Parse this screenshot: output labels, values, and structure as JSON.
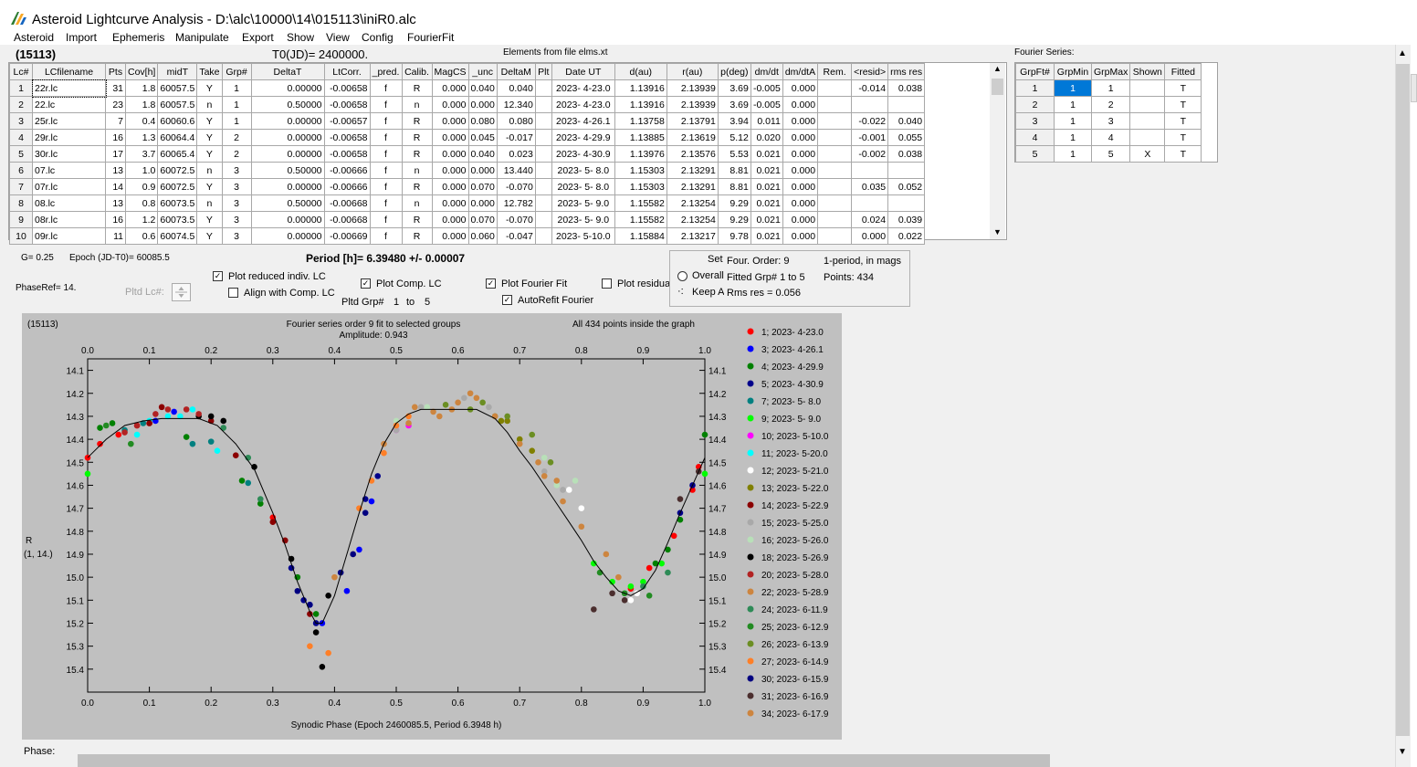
{
  "window": {
    "title": "Asteroid Lightcurve Analysis - D:\\alc\\10000\\14\\015113\\iniR0.alc"
  },
  "menu": [
    "Asteroid",
    "Import",
    "Ephemeris",
    "Manipulate",
    "Export",
    "Show",
    "View",
    "Config",
    "FourierFit"
  ],
  "header": {
    "asteroid_id": "(15113)",
    "t0": "T0(JD)= 2400000.",
    "elements": "Elements from file elms.xt",
    "fourier_title": "Fourier Series:"
  },
  "lc_table": {
    "columns": [
      "Lc#",
      "LCfilename",
      "Pts",
      "Cov[h]",
      "midT",
      "Take",
      "Grp#",
      "DeltaT",
      "LtCorr.",
      "_pred.",
      "Calib.",
      "MagCS",
      "_unc",
      "DeltaM",
      "Plt",
      "Date UT",
      "d(au)",
      "r(au)",
      "p(deg)",
      "dm/dt",
      "dm/dtA",
      "Rem.",
      "<resid>",
      "rms res"
    ],
    "rows": [
      [
        "1",
        "22r.lc",
        "31",
        "1.8",
        "60057.5",
        "Y",
        "1",
        "0.00000",
        "-0.00658",
        "f",
        "R",
        "0.000",
        "0.040",
        "0.040",
        "",
        "2023- 4-23.0",
        "1.13916",
        "2.13939",
        "3.69",
        "-0.005",
        "0.000",
        "",
        "-0.014",
        "0.038"
      ],
      [
        "2",
        "22.lc",
        "23",
        "1.8",
        "60057.5",
        "n",
        "1",
        "0.50000",
        "-0.00658",
        "f",
        "n",
        "0.000",
        "0.000",
        "12.340",
        "",
        "2023- 4-23.0",
        "1.13916",
        "2.13939",
        "3.69",
        "-0.005",
        "0.000",
        "",
        "",
        ""
      ],
      [
        "3",
        "25r.lc",
        "7",
        "0.4",
        "60060.6",
        "Y",
        "1",
        "0.00000",
        "-0.00657",
        "f",
        "R",
        "0.000",
        "0.080",
        "0.080",
        "",
        "2023- 4-26.1",
        "1.13758",
        "2.13791",
        "3.94",
        "0.011",
        "0.000",
        "",
        "-0.022",
        "0.040"
      ],
      [
        "4",
        "29r.lc",
        "16",
        "1.3",
        "60064.4",
        "Y",
        "2",
        "0.00000",
        "-0.00658",
        "f",
        "R",
        "0.000",
        "0.045",
        "-0.017",
        "",
        "2023- 4-29.9",
        "1.13885",
        "2.13619",
        "5.12",
        "0.020",
        "0.000",
        "",
        "-0.001",
        "0.055"
      ],
      [
        "5",
        "30r.lc",
        "17",
        "3.7",
        "60065.4",
        "Y",
        "2",
        "0.00000",
        "-0.00658",
        "f",
        "R",
        "0.000",
        "0.040",
        "0.023",
        "",
        "2023- 4-30.9",
        "1.13976",
        "2.13576",
        "5.53",
        "0.021",
        "0.000",
        "",
        "-0.002",
        "0.038"
      ],
      [
        "6",
        "07.lc",
        "13",
        "1.0",
        "60072.5",
        "n",
        "3",
        "0.50000",
        "-0.00666",
        "f",
        "n",
        "0.000",
        "0.000",
        "13.440",
        "",
        "2023- 5- 8.0",
        "1.15303",
        "2.13291",
        "8.81",
        "0.021",
        "0.000",
        "",
        "",
        ""
      ],
      [
        "7",
        "07r.lc",
        "14",
        "0.9",
        "60072.5",
        "Y",
        "3",
        "0.00000",
        "-0.00666",
        "f",
        "R",
        "0.000",
        "0.070",
        "-0.070",
        "",
        "2023- 5- 8.0",
        "1.15303",
        "2.13291",
        "8.81",
        "0.021",
        "0.000",
        "",
        "0.035",
        "0.052"
      ],
      [
        "8",
        "08.lc",
        "13",
        "0.8",
        "60073.5",
        "n",
        "3",
        "0.50000",
        "-0.00668",
        "f",
        "n",
        "0.000",
        "0.000",
        "12.782",
        "",
        "2023- 5- 9.0",
        "1.15582",
        "2.13254",
        "9.29",
        "0.021",
        "0.000",
        "",
        "",
        ""
      ],
      [
        "9",
        "08r.lc",
        "16",
        "1.2",
        "60073.5",
        "Y",
        "3",
        "0.00000",
        "-0.00668",
        "f",
        "R",
        "0.000",
        "0.070",
        "-0.070",
        "",
        "2023- 5- 9.0",
        "1.15582",
        "2.13254",
        "9.29",
        "0.021",
        "0.000",
        "",
        "0.024",
        "0.039"
      ],
      [
        "10",
        "09r.lc",
        "11",
        "0.6",
        "60074.5",
        "Y",
        "3",
        "0.00000",
        "-0.00669",
        "f",
        "R",
        "0.000",
        "0.060",
        "-0.047",
        "",
        "2023- 5-10.0",
        "1.15884",
        "2.13217",
        "9.78",
        "0.021",
        "0.000",
        "",
        "0.000",
        "0.022"
      ]
    ]
  },
  "fourier_table": {
    "columns": [
      "GrpFt#",
      "GrpMin",
      "GrpMax",
      "Shown",
      "Fitted"
    ],
    "rows": [
      [
        "1",
        "1",
        "1",
        "",
        "T"
      ],
      [
        "2",
        "1",
        "2",
        "",
        "T"
      ],
      [
        "3",
        "1",
        "3",
        "",
        "T"
      ],
      [
        "4",
        "1",
        "4",
        "",
        "T"
      ],
      [
        "5",
        "1",
        "5",
        "X",
        "T"
      ]
    ]
  },
  "controls": {
    "g_value": "G= 0.25",
    "epoch": "Epoch (JD-T0)= 60085.5",
    "period": "Period [h]= 6.39480 +/- 0.00007",
    "phase_ref": "PhaseRef= 14.",
    "pltd_lc": "Pltd Lc#:",
    "plot_reduced": "Plot reduced indiv. LC",
    "align_comp": "Align with Comp. LC",
    "plot_comp": "Plot Comp. LC",
    "pltd_grp": "Pltd Grp#",
    "pltd_grp_from": "1",
    "pltd_grp_to_word": "to",
    "pltd_grp_to": "5",
    "plot_fourier": "Plot Fourier Fit",
    "autorefit": "AutoRefit Fourier",
    "plot_residuals": "Plot residuals",
    "set_label": "Set",
    "overall": "Overall",
    "keep": "Keep A",
    "four_order": "Four. Order:  9",
    "one_period": "1-period, in mags",
    "fitted_grp": "Fitted Grp# 1 to 5",
    "points": "Points: 434",
    "rms_res": "Rms res    = 0.056",
    "phase_footer": "Phase:"
  },
  "checkbox_states": {
    "plot_reduced": true,
    "align_comp": false,
    "plot_comp": true,
    "plot_fourier": true,
    "autorefit": true,
    "plot_residuals": false
  },
  "chart_data": {
    "type": "scatter",
    "corner_label": "(15113)",
    "title": "Fourier series order 9 fit to selected groups",
    "subtitle": "Amplitude: 0.943",
    "note": "All 434 points inside the graph",
    "xlabel": "Synodic Phase (Epoch 2460085.5, Period 6.3948 h)",
    "ylabel": "R",
    "ylabel2": "(1, 14.)",
    "xlim": [
      0.0,
      1.0
    ],
    "ylim": [
      14.05,
      15.5
    ],
    "y_inverted": true,
    "x_ticks": [
      "0.0",
      "0.1",
      "0.2",
      "0.3",
      "0.4",
      "0.5",
      "0.6",
      "0.7",
      "0.8",
      "0.9",
      "1.0"
    ],
    "y_ticks": [
      "14.1",
      "14.2",
      "14.3",
      "14.4",
      "14.5",
      "14.6",
      "14.7",
      "14.8",
      "14.9",
      "15.0",
      "15.1",
      "15.2",
      "15.3",
      "15.4"
    ],
    "fit_curve": {
      "x": [
        0.0,
        0.03,
        0.06,
        0.09,
        0.12,
        0.15,
        0.18,
        0.21,
        0.24,
        0.27,
        0.3,
        0.32,
        0.34,
        0.36,
        0.37,
        0.38,
        0.4,
        0.42,
        0.44,
        0.46,
        0.48,
        0.5,
        0.52,
        0.54,
        0.56,
        0.6,
        0.63,
        0.66,
        0.68,
        0.7,
        0.72,
        0.74,
        0.76,
        0.78,
        0.8,
        0.82,
        0.84,
        0.86,
        0.88,
        0.9,
        0.92,
        0.94,
        0.96,
        0.98,
        1.0
      ],
      "y": [
        14.48,
        14.4,
        14.34,
        14.32,
        14.31,
        14.31,
        14.31,
        14.34,
        14.42,
        14.53,
        14.72,
        14.86,
        15.02,
        15.15,
        15.2,
        15.2,
        15.08,
        14.9,
        14.72,
        14.55,
        14.42,
        14.33,
        14.29,
        14.27,
        14.27,
        14.27,
        14.27,
        14.31,
        14.37,
        14.45,
        14.52,
        14.6,
        14.68,
        14.76,
        14.84,
        14.93,
        15.0,
        15.06,
        15.08,
        15.05,
        14.97,
        14.85,
        14.72,
        14.6,
        14.48
      ]
    },
    "series": [
      {
        "name": "1; 2023- 4-23.0",
        "color": "#ff0000",
        "x": [
          0.0,
          0.02,
          0.05,
          0.08,
          0.1,
          0.3,
          0.88,
          0.91,
          0.95,
          0.98,
          0.99
        ],
        "y": [
          14.48,
          14.42,
          14.38,
          14.34,
          14.33,
          14.74,
          15.05,
          14.96,
          14.82,
          14.62,
          14.52
        ]
      },
      {
        "name": "3; 2023- 4-26.1",
        "color": "#0000ff",
        "x": [
          0.36,
          0.38,
          0.42,
          0.44,
          0.46,
          0.11,
          0.14
        ],
        "y": [
          15.12,
          15.2,
          15.06,
          14.88,
          14.67,
          14.32,
          14.28
        ]
      },
      {
        "name": "4; 2023- 4-29.9",
        "color": "#008000",
        "x": [
          0.02,
          0.04,
          0.16,
          0.25,
          0.28,
          0.34,
          0.37,
          0.92,
          0.94,
          0.96,
          1.0
        ],
        "y": [
          14.35,
          14.33,
          14.39,
          14.58,
          14.68,
          15.0,
          15.16,
          14.94,
          14.88,
          14.75,
          14.38
        ]
      },
      {
        "name": "5; 2023- 4-30.9",
        "color": "#00008b",
        "x": [
          0.33,
          0.35,
          0.37,
          0.45,
          0.47,
          0.96,
          0.98
        ],
        "y": [
          14.96,
          15.1,
          15.2,
          14.66,
          14.56,
          14.72,
          14.6
        ]
      },
      {
        "name": "7; 2023- 5- 8.0",
        "color": "#008080",
        "x": [
          0.06,
          0.09,
          0.17,
          0.2,
          0.26
        ],
        "y": [
          14.36,
          14.33,
          14.42,
          14.41,
          14.59
        ]
      },
      {
        "name": "9; 2023- 5- 9.0",
        "color": "#00ff00",
        "x": [
          0.0,
          0.82,
          0.85,
          0.88,
          0.9,
          0.93,
          1.0
        ],
        "y": [
          14.55,
          14.94,
          15.02,
          15.04,
          15.02,
          14.94,
          14.55
        ]
      },
      {
        "name": "10; 2023- 5-10.0",
        "color": "#ff00ff",
        "x": [
          0.5,
          0.52
        ],
        "y": [
          14.36,
          14.34
        ]
      },
      {
        "name": "11; 2023- 5-20.0",
        "color": "#00ffff",
        "x": [
          0.08,
          0.1,
          0.13,
          0.15,
          0.17,
          0.21
        ],
        "y": [
          14.38,
          14.32,
          14.3,
          14.3,
          14.27,
          14.45
        ]
      },
      {
        "name": "12; 2023- 5-21.0",
        "color": "#ffffff",
        "x": [
          0.78,
          0.8,
          0.88,
          0.89
        ],
        "y": [
          14.62,
          14.7,
          15.1,
          15.07
        ]
      },
      {
        "name": "13; 2023- 5-22.0",
        "color": "#808000",
        "x": [
          0.66,
          0.67,
          0.68,
          0.7,
          0.72
        ],
        "y": [
          14.3,
          14.32,
          14.32,
          14.4,
          14.45
        ]
      },
      {
        "name": "14; 2023- 5-22.9",
        "color": "#8b0000",
        "x": [
          0.1,
          0.12,
          0.2,
          0.24,
          0.3,
          0.32,
          0.36
        ],
        "y": [
          14.33,
          14.26,
          14.32,
          14.47,
          14.76,
          14.84,
          15.16
        ]
      },
      {
        "name": "15; 2023- 5-25.0",
        "color": "#a9a9a9",
        "x": [
          0.5,
          0.54,
          0.61,
          0.65,
          0.74,
          0.77
        ],
        "y": [
          14.36,
          14.26,
          14.22,
          14.26,
          14.54,
          14.62
        ]
      },
      {
        "name": "16; 2023- 5-26.0",
        "color": "#b8e0b8",
        "x": [
          0.5,
          0.55,
          0.74,
          0.76,
          0.79
        ],
        "y": [
          14.32,
          14.26,
          14.48,
          14.6,
          14.58
        ]
      },
      {
        "name": "18; 2023- 5-26.9",
        "color": "#000000",
        "x": [
          0.18,
          0.2,
          0.22,
          0.27,
          0.33,
          0.37,
          0.38,
          0.39
        ],
        "y": [
          14.3,
          14.3,
          14.32,
          14.52,
          14.92,
          15.24,
          15.39,
          15.08
        ]
      },
      {
        "name": "20; 2023- 5-28.0",
        "color": "#b22222",
        "x": [
          0.06,
          0.08,
          0.11,
          0.13,
          0.16,
          0.18
        ],
        "y": [
          14.37,
          14.34,
          14.29,
          14.27,
          14.27,
          14.29
        ]
      },
      {
        "name": "22; 2023- 5-28.9",
        "color": "#cd853f",
        "x": [
          0.4,
          0.43,
          0.48,
          0.52,
          0.56,
          0.6,
          0.63,
          0.66,
          0.7,
          0.73,
          0.76,
          0.8,
          0.84,
          0.86
        ],
        "y": [
          15.0,
          14.9,
          14.42,
          14.33,
          14.28,
          14.24,
          14.22,
          14.3,
          14.42,
          14.5,
          14.58,
          14.78,
          14.9,
          15.0
        ]
      },
      {
        "name": "24; 2023- 6-11.9",
        "color": "#2e8b57",
        "x": [
          0.22,
          0.26,
          0.28,
          0.9,
          0.94
        ],
        "y": [
          14.35,
          14.48,
          14.66,
          15.04,
          14.98
        ]
      },
      {
        "name": "25; 2023- 6-12.9",
        "color": "#228b22",
        "x": [
          0.03,
          0.07,
          0.83,
          0.87,
          0.91
        ],
        "y": [
          14.34,
          14.42,
          14.98,
          15.07,
          15.08
        ]
      },
      {
        "name": "26; 2023- 6-13.9",
        "color": "#6b8e23",
        "x": [
          0.58,
          0.62,
          0.64,
          0.68,
          0.72,
          0.75
        ],
        "y": [
          14.25,
          14.27,
          14.24,
          14.3,
          14.38,
          14.5
        ]
      },
      {
        "name": "27; 2023- 6-14.9",
        "color": "#ff7f27",
        "x": [
          0.44,
          0.46,
          0.48,
          0.5,
          0.52,
          0.36,
          0.39
        ],
        "y": [
          14.7,
          14.58,
          14.46,
          14.34,
          14.3,
          15.3,
          15.33
        ]
      },
      {
        "name": "30; 2023- 6-15.9",
        "color": "#000080",
        "x": [
          0.34,
          0.36,
          0.41,
          0.43,
          0.45
        ],
        "y": [
          15.06,
          15.12,
          14.98,
          14.9,
          14.72
        ]
      },
      {
        "name": "31; 2023- 6-16.9",
        "color": "#4b2e2e",
        "x": [
          0.82,
          0.85,
          0.87,
          0.96,
          0.99
        ],
        "y": [
          15.14,
          15.07,
          15.1,
          14.66,
          14.54
        ]
      },
      {
        "name": "34; 2023- 6-17.9",
        "color": "#cd853f",
        "x": [
          0.53,
          0.57,
          0.59,
          0.62,
          0.74,
          0.77
        ],
        "y": [
          14.26,
          14.3,
          14.27,
          14.2,
          14.56,
          14.67
        ]
      }
    ]
  }
}
